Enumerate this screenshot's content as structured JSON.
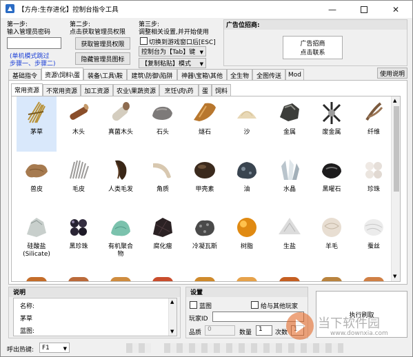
{
  "window": {
    "title": "【方舟:生存进化】控制台指令工具"
  },
  "steps": {
    "step1_title": "第一步:",
    "step1_desc": "输入管理员密码",
    "step1_note_line1": "(单机模式跳过",
    "step1_note_line2": "步骤一、步骤二)",
    "step2_title": "第二步:",
    "step2_desc": "点击获取管理员权限",
    "get_admin_button": "获取管理员权限",
    "hide_admin_icon_button": "隐藏管理员图标",
    "step3_title": "第三步:",
    "step3_desc": "调整相关设置,并开始使用",
    "switch_game_checkbox": "切换到游戏窗口后[ESC]",
    "console_select": "控制台为【Tab】键",
    "paste_select": "【复制粘贴】模式"
  },
  "ad": {
    "title": "广告位招商:",
    "button_line1": "广告招商",
    "button_line2": "点击联系"
  },
  "main_tabs": [
    "基础指令",
    "资源\\饲料\\蛋",
    "装备\\工具\\鞍",
    "建筑\\防御\\陷阱",
    "神器\\宝箱\\其他",
    "全生物",
    "全图传送",
    "Mod"
  ],
  "help_button": "使用说明",
  "sub_tabs": [
    "常用资源",
    "不常用资源",
    "加工资源",
    "农业\\果蔬资源",
    "烹饪\\肉\\药",
    "蛋",
    "饲料"
  ],
  "items": [
    {
      "label": "茅草",
      "icon": "thatch"
    },
    {
      "label": "木头",
      "icon": "wood"
    },
    {
      "label": "真菌木头",
      "icon": "fungal-wood"
    },
    {
      "label": "石头",
      "icon": "stone"
    },
    {
      "label": "燧石",
      "icon": "flint"
    },
    {
      "label": "沙",
      "icon": "sand"
    },
    {
      "label": "金属",
      "icon": "metal"
    },
    {
      "label": "废金属",
      "icon": "scrap-metal"
    },
    {
      "label": "纤维",
      "icon": "fiber"
    },
    {
      "label": "兽皮",
      "icon": "hide"
    },
    {
      "label": "毛皮",
      "icon": "pelt"
    },
    {
      "label": "人类毛发",
      "icon": "human-hair"
    },
    {
      "label": "角质",
      "icon": "keratin"
    },
    {
      "label": "甲壳素",
      "icon": "chitin"
    },
    {
      "label": "油",
      "icon": "oil"
    },
    {
      "label": "水晶",
      "icon": "crystal"
    },
    {
      "label": "黑曜石",
      "icon": "obsidian"
    },
    {
      "label": "珍珠",
      "icon": "pearl"
    },
    {
      "label": "硅酸盐",
      "label2": "(Silicate)",
      "icon": "silicate"
    },
    {
      "label": "黑珍珠",
      "icon": "black-pearl"
    },
    {
      "label": "有机聚合",
      "label2": "物",
      "icon": "polymer"
    },
    {
      "label": "腐化瘤",
      "icon": "corrupted-nodule"
    },
    {
      "label": "冷凝瓦斯",
      "icon": "condensed-gas"
    },
    {
      "label": "树脂",
      "icon": "amber"
    },
    {
      "label": "生盐",
      "icon": "raw-salt"
    },
    {
      "label": "羊毛",
      "icon": "wool"
    },
    {
      "label": "蚕丝",
      "icon": "silk"
    }
  ],
  "description": {
    "title": "说明",
    "lines": [
      "名称:",
      "茅草",
      "蓝图:"
    ]
  },
  "settings": {
    "title": "设置",
    "blueprint_checkbox": "蓝图",
    "give_to_others_checkbox": "给与其他玩家",
    "player_id_label": "玩家ID",
    "quality_label": "品质",
    "quality_value": "0",
    "quantity_label": "数量",
    "quantity_value": "1",
    "times_label": "次数",
    "times_value": "1"
  },
  "execute_button": "执行刷取",
  "hotkey": {
    "label": "呼出热键:",
    "value": "F1"
  },
  "watermark": {
    "brand": "当下软件园",
    "url": "www.downxia.com"
  },
  "colors": {
    "accent_blue": "#1b3fd6",
    "selected_bg": "#d9e8fb"
  }
}
